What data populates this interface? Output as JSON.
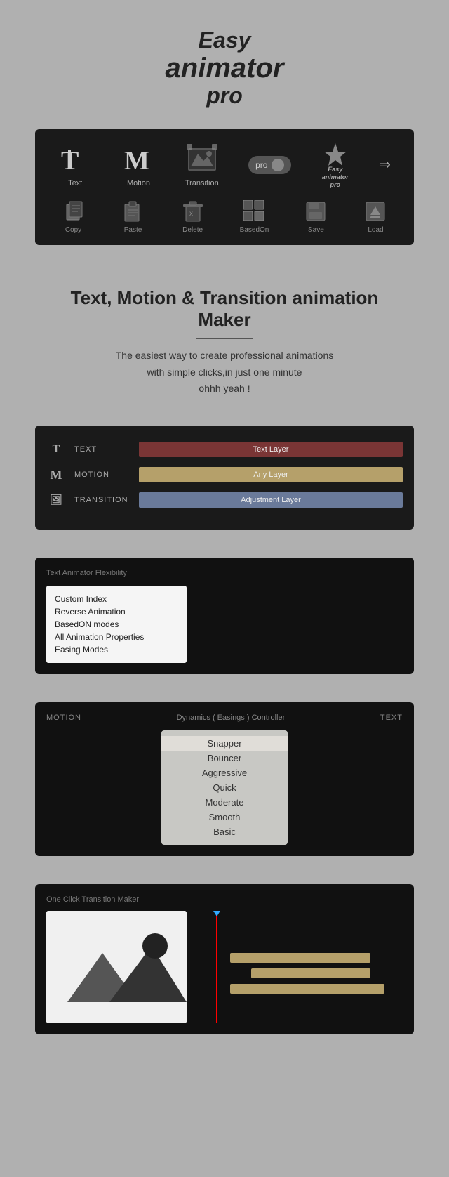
{
  "logo": {
    "line1": "Easy",
    "line2": "animator",
    "line3": "pro"
  },
  "toolbar": {
    "items": [
      {
        "id": "text",
        "label": "Text",
        "icon": "T"
      },
      {
        "id": "motion",
        "label": "Motion",
        "icon": "M"
      },
      {
        "id": "transition",
        "label": "Transition",
        "icon": "🖼"
      },
      {
        "id": "pro",
        "label": "pro"
      },
      {
        "id": "brand",
        "label": ""
      },
      {
        "id": "expand",
        "label": ""
      }
    ],
    "bottom_items": [
      {
        "id": "copy",
        "label": "Copy",
        "icon": "📄"
      },
      {
        "id": "paste",
        "label": "Paste",
        "icon": "📋"
      },
      {
        "id": "delete",
        "label": "Delete",
        "icon": "🗑"
      },
      {
        "id": "basedon",
        "label": "BasedOn",
        "icon": "⊞"
      },
      {
        "id": "save",
        "label": "Save",
        "icon": "💾"
      },
      {
        "id": "load",
        "label": "Load",
        "icon": "📥"
      }
    ]
  },
  "hero": {
    "title": "Text, Motion & Transition animation Maker",
    "subtitle1": "The easiest way to create professional animations",
    "subtitle2": "with simple clicks,in just one minute",
    "subtitle3": "ohhh yeah !"
  },
  "layers": {
    "items": [
      {
        "icon": "T",
        "label": "TEXT",
        "bar_text": "Text Layer",
        "bar_class": "bar-red"
      },
      {
        "icon": "M",
        "label": "MOTION",
        "bar_text": "Any Layer",
        "bar_class": "bar-tan"
      },
      {
        "icon": "🖼",
        "label": "TRANSITION",
        "bar_text": "Adjustment Layer",
        "bar_class": "bar-blue"
      }
    ]
  },
  "features": {
    "title": "Text Animator Flexibility",
    "list": [
      "Custom Index",
      "Reverse Animation",
      "BasedON modes",
      "All Animation Properties",
      "Easing Modes"
    ]
  },
  "dynamics": {
    "left_label": "MOTION",
    "center_label": "Dynamics ( Easings ) Controller",
    "right_label": "TEXT",
    "easing_options": [
      "Snapper",
      "Bouncer",
      "Aggressive",
      "Quick",
      "Moderate",
      "Smooth",
      "Basic"
    ]
  },
  "transition_section": {
    "title": "One Click Transition Maker"
  }
}
